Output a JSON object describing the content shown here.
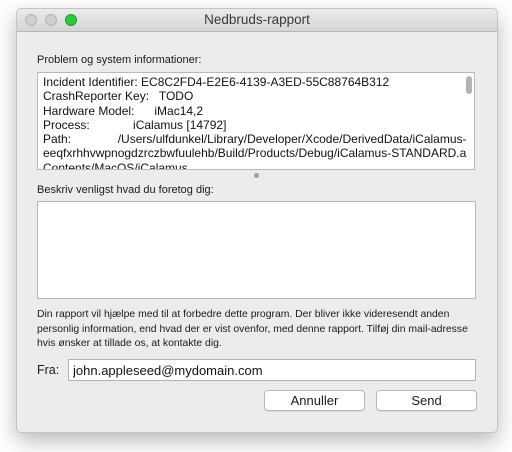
{
  "window": {
    "title": "Nedbruds-rapport"
  },
  "problem_section": {
    "label": "Problem og system informationer:",
    "report_lines": [
      "Incident Identifier: EC8C2FD4-E2E6-4139-A3ED-55C88764B312",
      "CrashReporter Key:   TODO",
      "Hardware Model:      iMac14,2",
      "Process:             iCalamus [14792]",
      "Path:              /Users/ulfdunkel/Library/Developer/Xcode/DerivedData/iCalamus-",
      "eeqfxrhhvwpnogdzrczbwfuulehb/Build/Products/Debug/iCalamus-STANDARD.a",
      "Contents/MacOS/iCalamus"
    ]
  },
  "description_section": {
    "label": "Beskriv venligst hvad du foretog dig:",
    "value": ""
  },
  "info_text": "Din rapport vil hjælpe med til at forbedre dette program. Der bliver ikke videresendt anden personlig information, end hvad der er vist ovenfor, med denne rapport. Tilføj din mail-adresse hvis ønsker at tillade os, at kontakte dig.",
  "from": {
    "label": "Fra:",
    "email": "john.appleseed@mydomain.com"
  },
  "buttons": {
    "cancel": "Annuller",
    "send": "Send"
  }
}
